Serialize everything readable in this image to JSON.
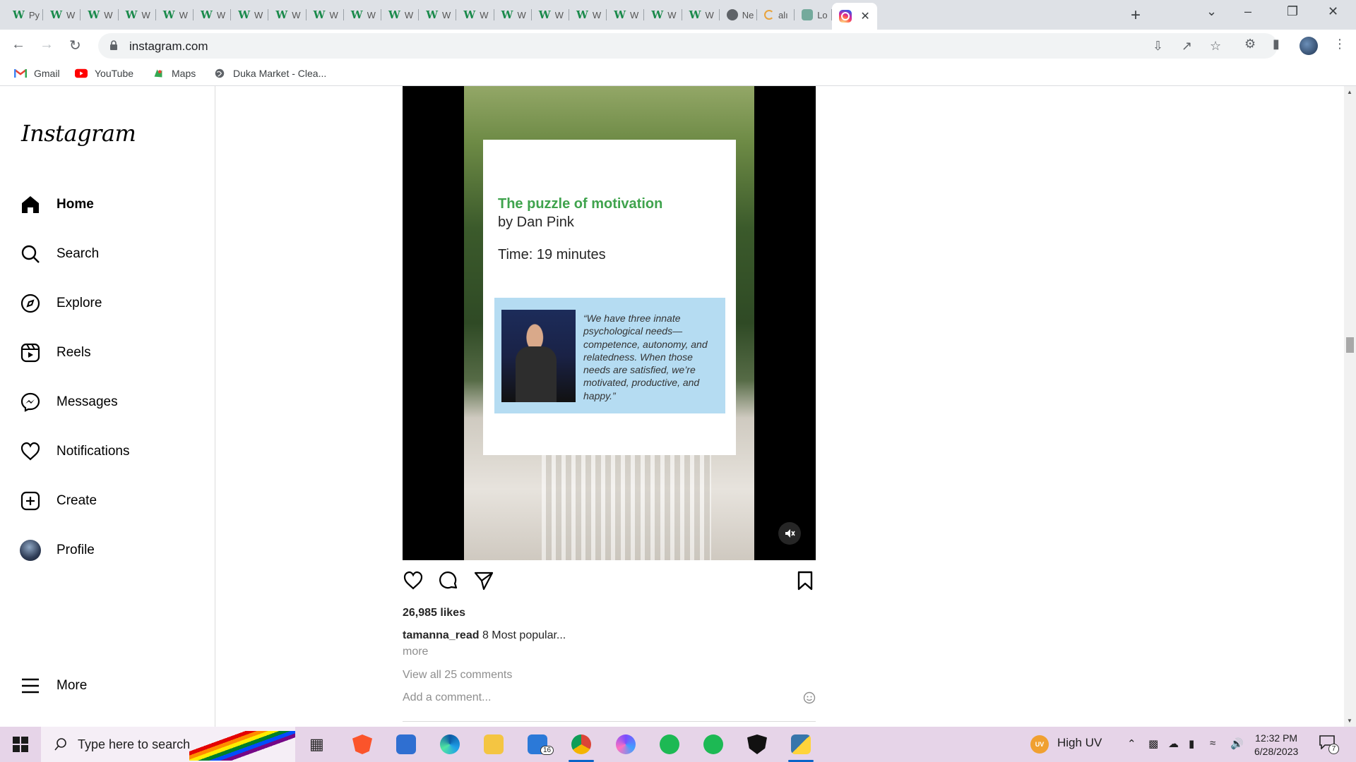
{
  "browser": {
    "tabs": [
      {
        "title": "Py",
        "icon": "w3schools-icon"
      },
      {
        "title": "W",
        "icon": "w3schools-icon"
      },
      {
        "title": "W",
        "icon": "w3schools-icon"
      },
      {
        "title": "W",
        "icon": "w3schools-icon"
      },
      {
        "title": "W",
        "icon": "w3schools-icon"
      },
      {
        "title": "W",
        "icon": "w3schools-icon"
      },
      {
        "title": "W",
        "icon": "w3schools-icon"
      },
      {
        "title": "W",
        "icon": "w3schools-icon"
      },
      {
        "title": "W",
        "icon": "w3schools-icon"
      },
      {
        "title": "W",
        "icon": "w3schools-icon"
      },
      {
        "title": "W",
        "icon": "w3schools-icon"
      },
      {
        "title": "W",
        "icon": "w3schools-icon"
      },
      {
        "title": "W",
        "icon": "w3schools-icon"
      },
      {
        "title": "W",
        "icon": "w3schools-icon"
      },
      {
        "title": "W",
        "icon": "w3schools-icon"
      },
      {
        "title": "W",
        "icon": "w3schools-icon"
      },
      {
        "title": "W",
        "icon": "w3schools-icon"
      },
      {
        "title": "W",
        "icon": "w3schools-icon"
      },
      {
        "title": "W",
        "icon": "w3schools-icon"
      },
      {
        "title": "Ne",
        "icon": "chrome-icon"
      },
      {
        "title": "alı",
        "icon": "loading-icon"
      },
      {
        "title": "Lo",
        "icon": "openai-icon"
      }
    ],
    "active_tab_close": "✕",
    "new_tab": "+",
    "url": "instagram.com",
    "bookmarks": [
      {
        "label": "Gmail",
        "icon": "gmail-icon"
      },
      {
        "label": "YouTube",
        "icon": "youtube-icon"
      },
      {
        "label": "Maps",
        "icon": "maps-icon"
      },
      {
        "label": "Duka Market - Clea...",
        "icon": "globe-icon"
      }
    ]
  },
  "instagram": {
    "logo": "Instagram",
    "nav": [
      {
        "label": "Home",
        "icon": "home-icon",
        "active": true
      },
      {
        "label": "Search",
        "icon": "search-icon"
      },
      {
        "label": "Explore",
        "icon": "compass-icon"
      },
      {
        "label": "Reels",
        "icon": "reels-icon"
      },
      {
        "label": "Messages",
        "icon": "messenger-icon"
      },
      {
        "label": "Notifications",
        "icon": "heart-icon"
      },
      {
        "label": "Create",
        "icon": "plus-square-icon"
      },
      {
        "label": "Profile",
        "icon": "avatar"
      }
    ],
    "more_label": "More",
    "post": {
      "card_title": "The puzzle of motivation",
      "card_author": "by Dan Pink",
      "card_time": "Time: 19 minutes",
      "quote": "“We have three innate psychological needs—competence, autonomy, and relatedness. When those needs are satisfied, we’re motivated, productive, and happy.”",
      "likes": "26,985 likes",
      "username": "tamanna_read",
      "caption": "8 Most popular...",
      "more": "more",
      "view_comments": "View all 25 comments",
      "comment_placeholder": "Add a comment...",
      "accent_color": "#3fa34d"
    }
  },
  "taskbar": {
    "search_placeholder": "Type here to search",
    "mail_badge": "16",
    "weather": "High UV",
    "uv_badge": "UV",
    "time": "12:32 PM",
    "date": "6/28/2023",
    "notification_count": "7"
  }
}
